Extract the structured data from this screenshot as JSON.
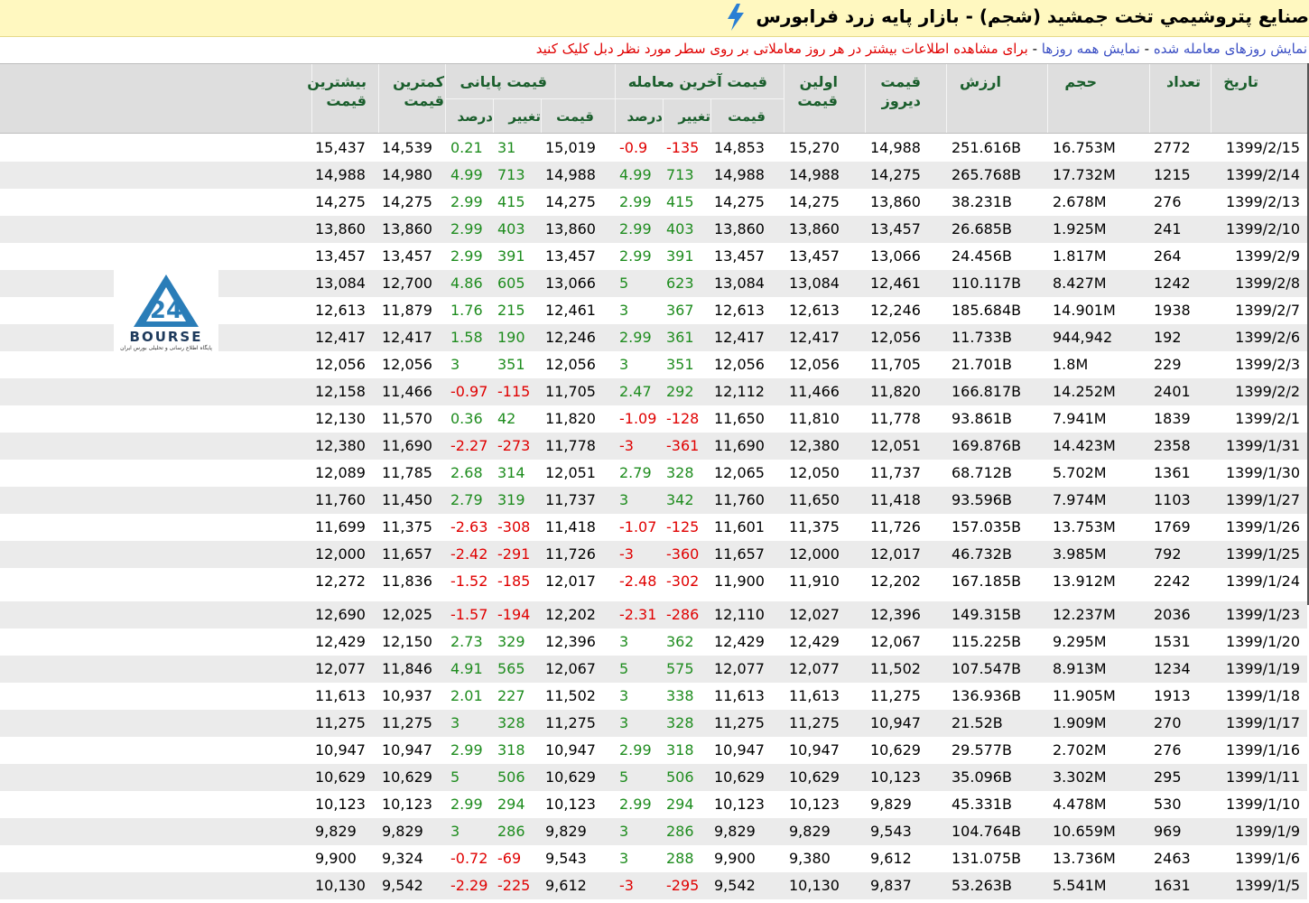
{
  "title": "صنايع پتروشيمي تخت جمشيد (شجم) - بازار پایه زرد فرابورس",
  "info": {
    "link_traded_days": "نمایش روزهای معامله شده",
    "sep1": " - ",
    "link_all_days": "نمایش همه روزها",
    "sep2": " - ",
    "hint": "برای مشاهده اطلاعات بیشتر در هر روز معاملاتی بر روی سطر مورد نظر دبل کلیک کنید"
  },
  "headers": {
    "date": "تاریخ",
    "count": "تعداد",
    "volume": "حجم",
    "value": "ارزش",
    "yesterday": "قیمت دیروز",
    "first": "اولین قیمت",
    "last_trade": "قیمت آخرین معامله",
    "closing": "قیمت پایانی",
    "price": "قیمت",
    "change": "تغییر",
    "percent": "درصد",
    "min": "کمترین قیمت",
    "max": "بیشترین قیمت"
  },
  "logo": {
    "text": "BOURSE",
    "number": "24",
    "subtitle": "پایگاه اطلاع رسانی و تحلیلی بورس ایران"
  },
  "rows": [
    [
      "1399/2/15",
      "2772",
      "16.753M",
      "251.616B",
      "14,988",
      "15,270",
      "14,853",
      "-135",
      "-0.9",
      "15,019",
      "31",
      "0.21",
      "14,539",
      "15,437"
    ],
    [
      "1399/2/14",
      "1215",
      "17.732M",
      "265.768B",
      "14,275",
      "14,988",
      "14,988",
      "713",
      "4.99",
      "14,988",
      "713",
      "4.99",
      "14,980",
      "14,988"
    ],
    [
      "1399/2/13",
      "276",
      "2.678M",
      "38.231B",
      "13,860",
      "14,275",
      "14,275",
      "415",
      "2.99",
      "14,275",
      "415",
      "2.99",
      "14,275",
      "14,275"
    ],
    [
      "1399/2/10",
      "241",
      "1.925M",
      "26.685B",
      "13,457",
      "13,860",
      "13,860",
      "403",
      "2.99",
      "13,860",
      "403",
      "2.99",
      "13,860",
      "13,860"
    ],
    [
      "1399/2/9",
      "264",
      "1.817M",
      "24.456B",
      "13,066",
      "13,457",
      "13,457",
      "391",
      "2.99",
      "13,457",
      "391",
      "2.99",
      "13,457",
      "13,457"
    ],
    [
      "1399/2/8",
      "1242",
      "8.427M",
      "110.117B",
      "12,461",
      "13,084",
      "13,084",
      "623",
      "5",
      "13,066",
      "605",
      "4.86",
      "12,700",
      "13,084"
    ],
    [
      "1399/2/7",
      "1938",
      "14.901M",
      "185.684B",
      "12,246",
      "12,613",
      "12,613",
      "367",
      "3",
      "12,461",
      "215",
      "1.76",
      "11,879",
      "12,613"
    ],
    [
      "1399/2/6",
      "192",
      "944,942",
      "11.733B",
      "12,056",
      "12,417",
      "12,417",
      "361",
      "2.99",
      "12,246",
      "190",
      "1.58",
      "12,417",
      "12,417"
    ],
    [
      "1399/2/3",
      "229",
      "1.8M",
      "21.701B",
      "11,705",
      "12,056",
      "12,056",
      "351",
      "3",
      "12,056",
      "351",
      "3",
      "12,056",
      "12,056"
    ],
    [
      "1399/2/2",
      "2401",
      "14.252M",
      "166.817B",
      "11,820",
      "11,466",
      "12,112",
      "292",
      "2.47",
      "11,705",
      "-115",
      "-0.97",
      "11,466",
      "12,158"
    ],
    [
      "1399/2/1",
      "1839",
      "7.941M",
      "93.861B",
      "11,778",
      "11,810",
      "11,650",
      "-128",
      "-1.09",
      "11,820",
      "42",
      "0.36",
      "11,570",
      "12,130"
    ],
    [
      "1399/1/31",
      "2358",
      "14.423M",
      "169.876B",
      "12,051",
      "12,380",
      "11,690",
      "-361",
      "-3",
      "11,778",
      "-273",
      "-2.27",
      "11,690",
      "12,380"
    ],
    [
      "1399/1/30",
      "1361",
      "5.702M",
      "68.712B",
      "11,737",
      "12,050",
      "12,065",
      "328",
      "2.79",
      "12,051",
      "314",
      "2.68",
      "11,785",
      "12,089"
    ],
    [
      "1399/1/27",
      "1103",
      "7.974M",
      "93.596B",
      "11,418",
      "11,650",
      "11,760",
      "342",
      "3",
      "11,737",
      "319",
      "2.79",
      "11,450",
      "11,760"
    ],
    [
      "1399/1/26",
      "1769",
      "13.753M",
      "157.035B",
      "11,726",
      "11,375",
      "11,601",
      "-125",
      "-1.07",
      "11,418",
      "-308",
      "-2.63",
      "11,375",
      "11,699"
    ],
    [
      "1399/1/25",
      "792",
      "3.985M",
      "46.732B",
      "12,017",
      "12,000",
      "11,657",
      "-360",
      "-3",
      "11,726",
      "-291",
      "-2.42",
      "11,657",
      "12,000"
    ],
    [
      "1399/1/24",
      "2242",
      "13.912M",
      "167.185B",
      "12,202",
      "11,910",
      "11,900",
      "-302",
      "-2.48",
      "12,017",
      "-185",
      "-1.52",
      "11,836",
      "12,272"
    ],
    [
      "1399/1/23",
      "2036",
      "12.237M",
      "149.315B",
      "12,396",
      "12,027",
      "12,110",
      "-286",
      "-2.31",
      "12,202",
      "-194",
      "-1.57",
      "12,025",
      "12,690"
    ],
    [
      "1399/1/20",
      "1531",
      "9.295M",
      "115.225B",
      "12,067",
      "12,429",
      "12,429",
      "362",
      "3",
      "12,396",
      "329",
      "2.73",
      "12,150",
      "12,429"
    ],
    [
      "1399/1/19",
      "1234",
      "8.913M",
      "107.547B",
      "11,502",
      "12,077",
      "12,077",
      "575",
      "5",
      "12,067",
      "565",
      "4.91",
      "11,846",
      "12,077"
    ],
    [
      "1399/1/18",
      "1913",
      "11.905M",
      "136.936B",
      "11,275",
      "11,613",
      "11,613",
      "338",
      "3",
      "11,502",
      "227",
      "2.01",
      "10,937",
      "11,613"
    ],
    [
      "1399/1/17",
      "270",
      "1.909M",
      "21.52B",
      "10,947",
      "11,275",
      "11,275",
      "328",
      "3",
      "11,275",
      "328",
      "3",
      "11,275",
      "11,275"
    ],
    [
      "1399/1/16",
      "276",
      "2.702M",
      "29.577B",
      "10,629",
      "10,947",
      "10,947",
      "318",
      "2.99",
      "10,947",
      "318",
      "2.99",
      "10,947",
      "10,947"
    ],
    [
      "1399/1/11",
      "295",
      "3.302M",
      "35.096B",
      "10,123",
      "10,629",
      "10,629",
      "506",
      "5",
      "10,629",
      "506",
      "5",
      "10,629",
      "10,629"
    ],
    [
      "1399/1/10",
      "530",
      "4.478M",
      "45.331B",
      "9,829",
      "10,123",
      "10,123",
      "294",
      "2.99",
      "10,123",
      "294",
      "2.99",
      "10,123",
      "10,123"
    ],
    [
      "1399/1/9",
      "969",
      "10.659M",
      "104.764B",
      "9,543",
      "9,829",
      "9,829",
      "286",
      "3",
      "9,829",
      "286",
      "3",
      "9,829",
      "9,829"
    ],
    [
      "1399/1/6",
      "2463",
      "13.736M",
      "131.075B",
      "9,612",
      "9,380",
      "9,900",
      "288",
      "3",
      "9,543",
      "-69",
      "-0.72",
      "9,324",
      "9,900"
    ],
    [
      "1399/1/5",
      "1631",
      "5.541M",
      "53.263B",
      "9,837",
      "10,130",
      "9,542",
      "-295",
      "-3",
      "9,612",
      "-225",
      "-2.29",
      "9,542",
      "10,130"
    ]
  ],
  "colors": {
    "positive": "#1e8c1e",
    "negative": "#e00000",
    "header_text": "#1a5e2c",
    "title_bg": "#fff8c0"
  }
}
